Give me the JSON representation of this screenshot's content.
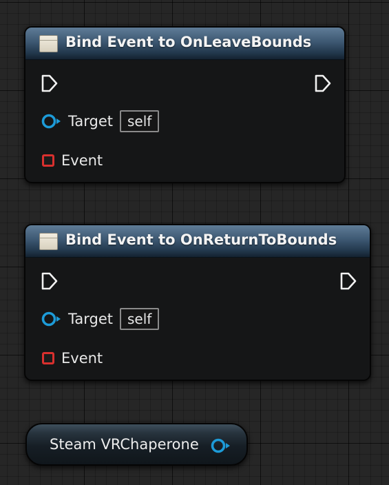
{
  "nodes": [
    {
      "title": "Bind Event to OnLeaveBounds",
      "target_label": "Target",
      "target_default": "self",
      "event_label": "Event"
    },
    {
      "title": "Bind Event to OnReturnToBounds",
      "target_label": "Target",
      "target_default": "self",
      "event_label": "Event"
    }
  ],
  "reference_node": {
    "label": "Steam VRChaperone"
  },
  "colors": {
    "header": "#3d5872",
    "object_pin": "#1d9bd8",
    "delegate_pin": "#d9302e",
    "exec_pin": "#f2f2f2",
    "graph_background": "#262626"
  },
  "icons": {
    "function_node": "function-icon",
    "exec": "exec-pin-icon",
    "object": "object-pin-icon",
    "delegate": "delegate-pin-icon"
  }
}
